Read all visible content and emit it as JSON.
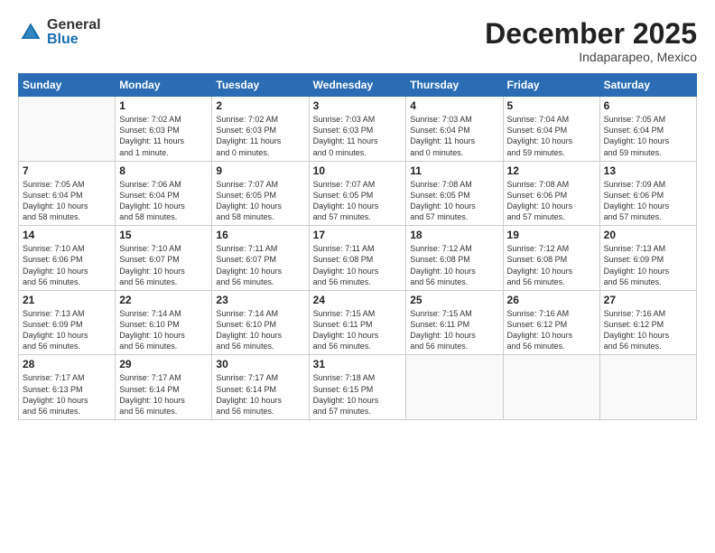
{
  "logo": {
    "general": "General",
    "blue": "Blue"
  },
  "header": {
    "month": "December 2025",
    "location": "Indaparapeo, Mexico"
  },
  "weekdays": [
    "Sunday",
    "Monday",
    "Tuesday",
    "Wednesday",
    "Thursday",
    "Friday",
    "Saturday"
  ],
  "weeks": [
    [
      {
        "day": "",
        "info": ""
      },
      {
        "day": "1",
        "info": "Sunrise: 7:02 AM\nSunset: 6:03 PM\nDaylight: 11 hours\nand 1 minute."
      },
      {
        "day": "2",
        "info": "Sunrise: 7:02 AM\nSunset: 6:03 PM\nDaylight: 11 hours\nand 0 minutes."
      },
      {
        "day": "3",
        "info": "Sunrise: 7:03 AM\nSunset: 6:03 PM\nDaylight: 11 hours\nand 0 minutes."
      },
      {
        "day": "4",
        "info": "Sunrise: 7:03 AM\nSunset: 6:04 PM\nDaylight: 11 hours\nand 0 minutes."
      },
      {
        "day": "5",
        "info": "Sunrise: 7:04 AM\nSunset: 6:04 PM\nDaylight: 10 hours\nand 59 minutes."
      },
      {
        "day": "6",
        "info": "Sunrise: 7:05 AM\nSunset: 6:04 PM\nDaylight: 10 hours\nand 59 minutes."
      }
    ],
    [
      {
        "day": "7",
        "info": "Sunrise: 7:05 AM\nSunset: 6:04 PM\nDaylight: 10 hours\nand 58 minutes."
      },
      {
        "day": "8",
        "info": "Sunrise: 7:06 AM\nSunset: 6:04 PM\nDaylight: 10 hours\nand 58 minutes."
      },
      {
        "day": "9",
        "info": "Sunrise: 7:07 AM\nSunset: 6:05 PM\nDaylight: 10 hours\nand 58 minutes."
      },
      {
        "day": "10",
        "info": "Sunrise: 7:07 AM\nSunset: 6:05 PM\nDaylight: 10 hours\nand 57 minutes."
      },
      {
        "day": "11",
        "info": "Sunrise: 7:08 AM\nSunset: 6:05 PM\nDaylight: 10 hours\nand 57 minutes."
      },
      {
        "day": "12",
        "info": "Sunrise: 7:08 AM\nSunset: 6:06 PM\nDaylight: 10 hours\nand 57 minutes."
      },
      {
        "day": "13",
        "info": "Sunrise: 7:09 AM\nSunset: 6:06 PM\nDaylight: 10 hours\nand 57 minutes."
      }
    ],
    [
      {
        "day": "14",
        "info": "Sunrise: 7:10 AM\nSunset: 6:06 PM\nDaylight: 10 hours\nand 56 minutes."
      },
      {
        "day": "15",
        "info": "Sunrise: 7:10 AM\nSunset: 6:07 PM\nDaylight: 10 hours\nand 56 minutes."
      },
      {
        "day": "16",
        "info": "Sunrise: 7:11 AM\nSunset: 6:07 PM\nDaylight: 10 hours\nand 56 minutes."
      },
      {
        "day": "17",
        "info": "Sunrise: 7:11 AM\nSunset: 6:08 PM\nDaylight: 10 hours\nand 56 minutes."
      },
      {
        "day": "18",
        "info": "Sunrise: 7:12 AM\nSunset: 6:08 PM\nDaylight: 10 hours\nand 56 minutes."
      },
      {
        "day": "19",
        "info": "Sunrise: 7:12 AM\nSunset: 6:08 PM\nDaylight: 10 hours\nand 56 minutes."
      },
      {
        "day": "20",
        "info": "Sunrise: 7:13 AM\nSunset: 6:09 PM\nDaylight: 10 hours\nand 56 minutes."
      }
    ],
    [
      {
        "day": "21",
        "info": "Sunrise: 7:13 AM\nSunset: 6:09 PM\nDaylight: 10 hours\nand 56 minutes."
      },
      {
        "day": "22",
        "info": "Sunrise: 7:14 AM\nSunset: 6:10 PM\nDaylight: 10 hours\nand 56 minutes."
      },
      {
        "day": "23",
        "info": "Sunrise: 7:14 AM\nSunset: 6:10 PM\nDaylight: 10 hours\nand 56 minutes."
      },
      {
        "day": "24",
        "info": "Sunrise: 7:15 AM\nSunset: 6:11 PM\nDaylight: 10 hours\nand 56 minutes."
      },
      {
        "day": "25",
        "info": "Sunrise: 7:15 AM\nSunset: 6:11 PM\nDaylight: 10 hours\nand 56 minutes."
      },
      {
        "day": "26",
        "info": "Sunrise: 7:16 AM\nSunset: 6:12 PM\nDaylight: 10 hours\nand 56 minutes."
      },
      {
        "day": "27",
        "info": "Sunrise: 7:16 AM\nSunset: 6:12 PM\nDaylight: 10 hours\nand 56 minutes."
      }
    ],
    [
      {
        "day": "28",
        "info": "Sunrise: 7:17 AM\nSunset: 6:13 PM\nDaylight: 10 hours\nand 56 minutes."
      },
      {
        "day": "29",
        "info": "Sunrise: 7:17 AM\nSunset: 6:14 PM\nDaylight: 10 hours\nand 56 minutes."
      },
      {
        "day": "30",
        "info": "Sunrise: 7:17 AM\nSunset: 6:14 PM\nDaylight: 10 hours\nand 56 minutes."
      },
      {
        "day": "31",
        "info": "Sunrise: 7:18 AM\nSunset: 6:15 PM\nDaylight: 10 hours\nand 57 minutes."
      },
      {
        "day": "",
        "info": ""
      },
      {
        "day": "",
        "info": ""
      },
      {
        "day": "",
        "info": ""
      }
    ]
  ]
}
